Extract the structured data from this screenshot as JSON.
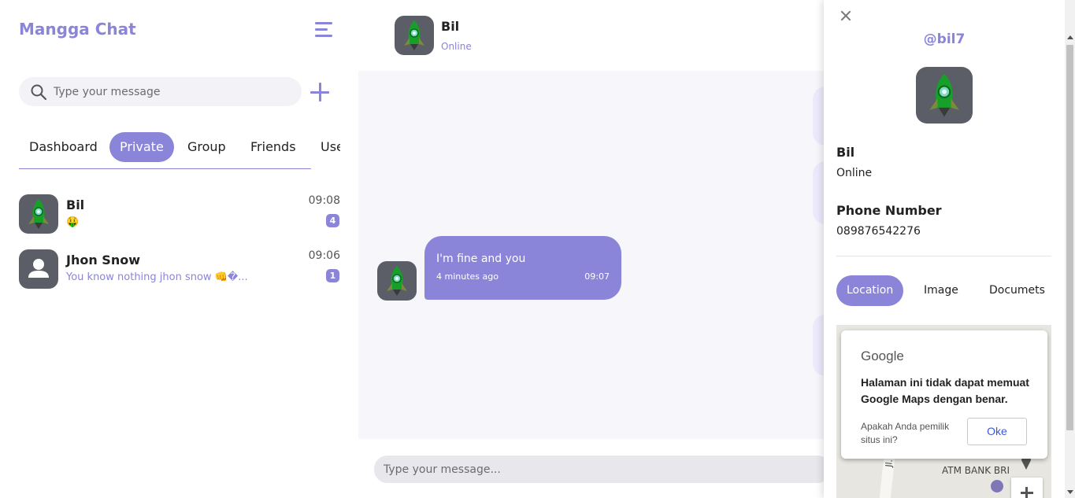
{
  "app": {
    "title": "Mangga Chat"
  },
  "search": {
    "placeholder": "Type your message"
  },
  "tabs": [
    {
      "label": "Dashboard",
      "active": false
    },
    {
      "label": "Private",
      "active": true
    },
    {
      "label": "Group",
      "active": false
    },
    {
      "label": "Friends",
      "active": false
    },
    {
      "label": "Users",
      "active": false
    }
  ],
  "chats": [
    {
      "name": "Bil",
      "preview": "🤑",
      "time": "09:08",
      "unread": "4",
      "avatar": "rocket-avatar"
    },
    {
      "name": "Jhon Snow",
      "preview": "You know nothing jhon snow 👊�...",
      "time": "09:06",
      "unread": "1",
      "avatar": "person-placeholder-avatar"
    }
  ],
  "conversation": {
    "name": "Bil",
    "status": "Online",
    "messages": [
      {
        "text": "I'm fine and you",
        "relative_time": "4 minutes ago",
        "time": "09:07"
      }
    ]
  },
  "composer": {
    "placeholder": "Type your message..."
  },
  "profile": {
    "handle": "@bil7",
    "name": "Bil",
    "status": "Online",
    "phone_label": "Phone Number",
    "phone": "089876542276",
    "tabs": [
      {
        "label": "Location",
        "active": true
      },
      {
        "label": "Image",
        "active": false
      },
      {
        "label": "Documets",
        "active": false
      }
    ]
  },
  "map": {
    "provider": "Google",
    "error_message": "Halaman ini tidak dapat memuat Google Maps dengan benar.",
    "owner_question": "Apakah Anda pemilik situs ini?",
    "ok_label": "Oke",
    "street_label": "Jl. Banc",
    "place_label": "ATM BANK BRI"
  },
  "colors": {
    "accent": "#8a85d8",
    "chat_bg": "#f7f7fb"
  }
}
